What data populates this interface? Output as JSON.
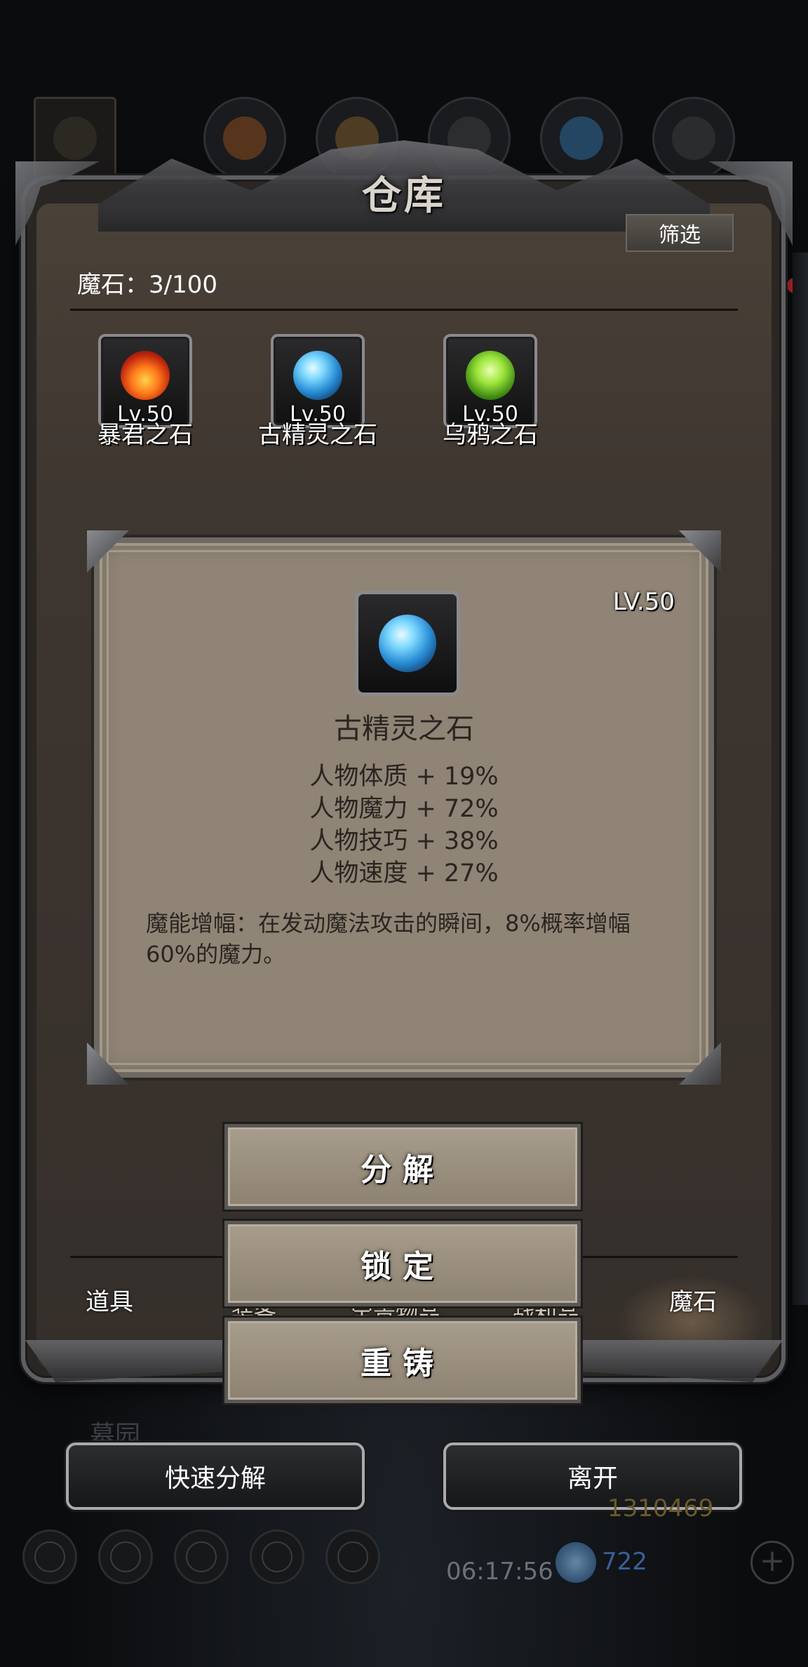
{
  "screen": {
    "title": "仓库",
    "filter_label": "筛选",
    "stone_count_label": "魔石：3/100"
  },
  "items": [
    {
      "name": "暴君之石",
      "level": "Lv.50",
      "icon": "fire-stone-icon"
    },
    {
      "name": "古精灵之石",
      "level": "Lv.50",
      "icon": "blue-orb-stone-icon"
    },
    {
      "name": "乌鸦之石",
      "level": "Lv.50",
      "icon": "green-crystal-stone-icon"
    }
  ],
  "detail": {
    "level": "LV.50",
    "name": "古精灵之石",
    "stats": [
      "人物体质 + 19%",
      "人物魔力 + 72%",
      "人物技巧 + 38%",
      "人物速度 + 27%"
    ],
    "skill_text": "魔能增幅：在发动魔法攻击的瞬间，8%概率增幅60%的魔力。"
  },
  "actions": {
    "decompose": "分解",
    "lock": "锁定",
    "reforge": "重铸"
  },
  "tabs": {
    "items": "道具",
    "equipment": "装备",
    "treasure": "宝贵物品",
    "trophies": "战利品",
    "magic_stone": "魔石"
  },
  "footer": {
    "quick_decompose": "快速分解",
    "leave": "离开",
    "bg_location": "墓园",
    "time": "06:17:56",
    "gold": "1310469",
    "diamonds": "722"
  },
  "colors": {
    "panel_parchment": "#8f8475",
    "frame_metal": "#5e5f63",
    "text_dark": "#2b2521"
  }
}
